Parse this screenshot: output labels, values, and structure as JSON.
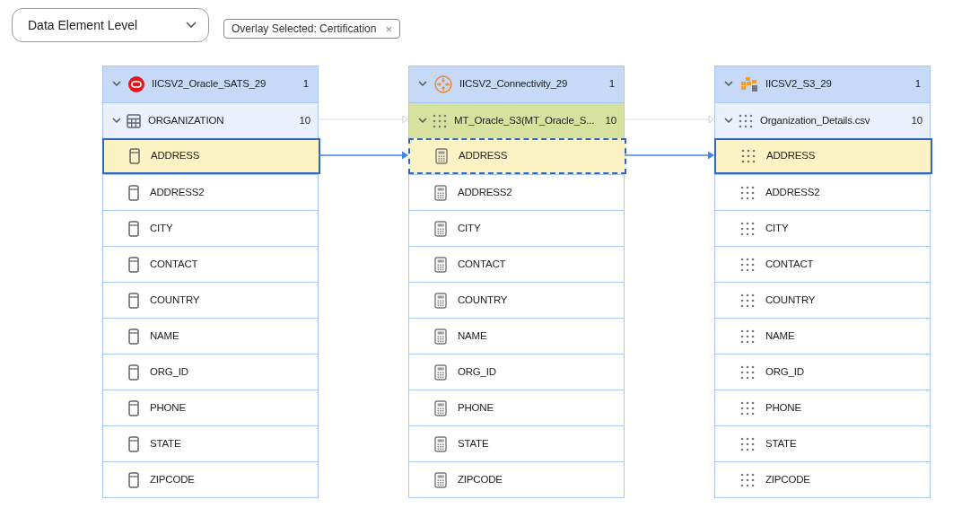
{
  "level_dropdown": {
    "value": "Data Element Level"
  },
  "overlay_chip": {
    "label": "Overlay Selected: Certification",
    "close": "×"
  },
  "panels": [
    {
      "kind": "oracle",
      "title": "IICSV2_Oracle_SATS_29",
      "count": "1",
      "expanded": true,
      "group": {
        "kind": "table",
        "name": "ORGANIZATION",
        "count": "10",
        "expanded": true
      },
      "fields": [
        {
          "name": "ADDRESS",
          "selected": true
        },
        {
          "name": "ADDRESS2",
          "selected": false
        },
        {
          "name": "CITY",
          "selected": false
        },
        {
          "name": "CONTACT",
          "selected": false
        },
        {
          "name": "COUNTRY",
          "selected": false
        },
        {
          "name": "NAME",
          "selected": false
        },
        {
          "name": "ORG_ID",
          "selected": false
        },
        {
          "name": "PHONE",
          "selected": false
        },
        {
          "name": "STATE",
          "selected": false
        },
        {
          "name": "ZIPCODE",
          "selected": false
        }
      ]
    },
    {
      "kind": "connectivity",
      "title": "IICSV2_Connectivity_29",
      "count": "1",
      "expanded": true,
      "group": {
        "kind": "mapping",
        "name": "MT_Oracle_S3(MT_Oracle_S...",
        "count": "10",
        "expanded": true
      },
      "fields": [
        {
          "name": "ADDRESS",
          "selected": true
        },
        {
          "name": "ADDRESS2",
          "selected": false
        },
        {
          "name": "CITY",
          "selected": false
        },
        {
          "name": "CONTACT",
          "selected": false
        },
        {
          "name": "COUNTRY",
          "selected": false
        },
        {
          "name": "NAME",
          "selected": false
        },
        {
          "name": "ORG_ID",
          "selected": false
        },
        {
          "name": "PHONE",
          "selected": false
        },
        {
          "name": "STATE",
          "selected": false
        },
        {
          "name": "ZIPCODE",
          "selected": false
        }
      ]
    },
    {
      "kind": "s3",
      "title": "IICSV2_S3_29",
      "count": "1",
      "expanded": true,
      "group": {
        "kind": "file",
        "name": "Organization_Details.csv",
        "count": "10",
        "expanded": true
      },
      "fields": [
        {
          "name": "ADDRESS",
          "selected": true
        },
        {
          "name": "ADDRESS2",
          "selected": false
        },
        {
          "name": "CITY",
          "selected": false
        },
        {
          "name": "CONTACT",
          "selected": false
        },
        {
          "name": "COUNTRY",
          "selected": false
        },
        {
          "name": "NAME",
          "selected": false
        },
        {
          "name": "ORG_ID",
          "selected": false
        },
        {
          "name": "PHONE",
          "selected": false
        },
        {
          "name": "STATE",
          "selected": false
        },
        {
          "name": "ZIPCODE",
          "selected": false
        }
      ]
    }
  ]
}
